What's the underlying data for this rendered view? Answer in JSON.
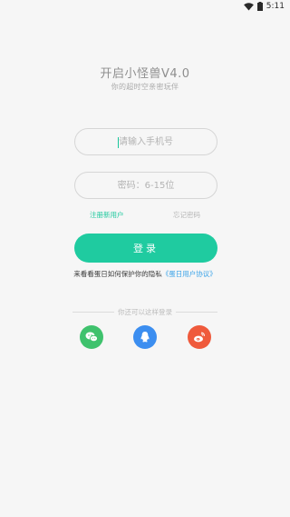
{
  "status_bar": {
    "time": "5:11"
  },
  "header": {
    "title": "开启小怪兽V4.0",
    "subtitle": "你的超时空亲密玩伴"
  },
  "form": {
    "phone_placeholder": "请输入手机号",
    "password_placeholder": "密码：6-15位",
    "register_label": "注册新用户",
    "forgot_label": "忘记密码",
    "login_label": "登录"
  },
  "privacy": {
    "text": "来看看蛋日如何保护你的隐私",
    "agreement": "《蛋日用户协议》"
  },
  "social": {
    "divider_text": "你还可以这样登录",
    "wechat_icon": "wechat-icon",
    "qq_icon": "qq-icon",
    "weibo_icon": "weibo-icon"
  },
  "colors": {
    "accent": "#1fcba0",
    "link": "#3aa3e8",
    "wechat": "#3fc26d",
    "qq": "#3c8ef0",
    "weibo": "#ef5a3c"
  }
}
